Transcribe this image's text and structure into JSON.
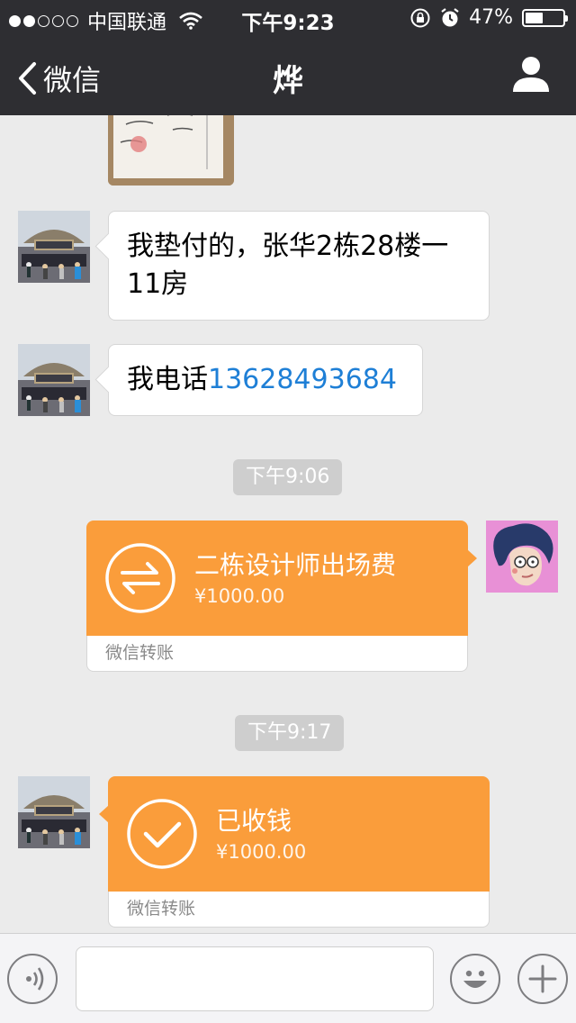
{
  "status_bar": {
    "carrier": "中国联通",
    "time": "下午9:23",
    "battery_percent": "47%",
    "battery_level": 0.47,
    "signal_dots_filled": 2,
    "signal_dots_total": 5
  },
  "nav": {
    "back_label": "微信",
    "title": "烨"
  },
  "messages": {
    "m1_text": "我垫付的，张华2栋28楼一11房",
    "m2_prefix": "我电话",
    "m2_phone": "13628493684",
    "time1": "下午9:06",
    "transfer1": {
      "title": "二栋设计师出场费",
      "amount": "¥1000.00",
      "footer": "微信转账"
    },
    "time2": "下午9:17",
    "transfer2": {
      "title": "已收钱",
      "amount": "¥1000.00",
      "footer": "微信转账"
    }
  },
  "input_bar": {
    "text_value": ""
  },
  "colors": {
    "nav_bg": "#2e2e32",
    "chat_bg": "#ebebeb",
    "transfer_orange": "#fa9d3b",
    "link_blue": "#1e7fd6"
  },
  "icons": [
    "wifi-icon",
    "lock-rotation-icon",
    "alarm-icon",
    "battery-icon",
    "back-chevron-icon",
    "profile-icon",
    "transfer-arrows-icon",
    "checkmark-icon",
    "voice-icon",
    "emoji-icon",
    "plus-icon"
  ]
}
